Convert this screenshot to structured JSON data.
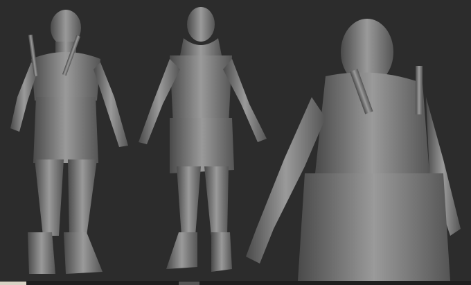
{
  "scene": {
    "subject": "",
    "colors": {
      "background": "#2c2c2c",
      "sculpt": "#8a8a8a",
      "shadow": "#4a4a4a",
      "highlight": "#b0b0b0"
    }
  }
}
